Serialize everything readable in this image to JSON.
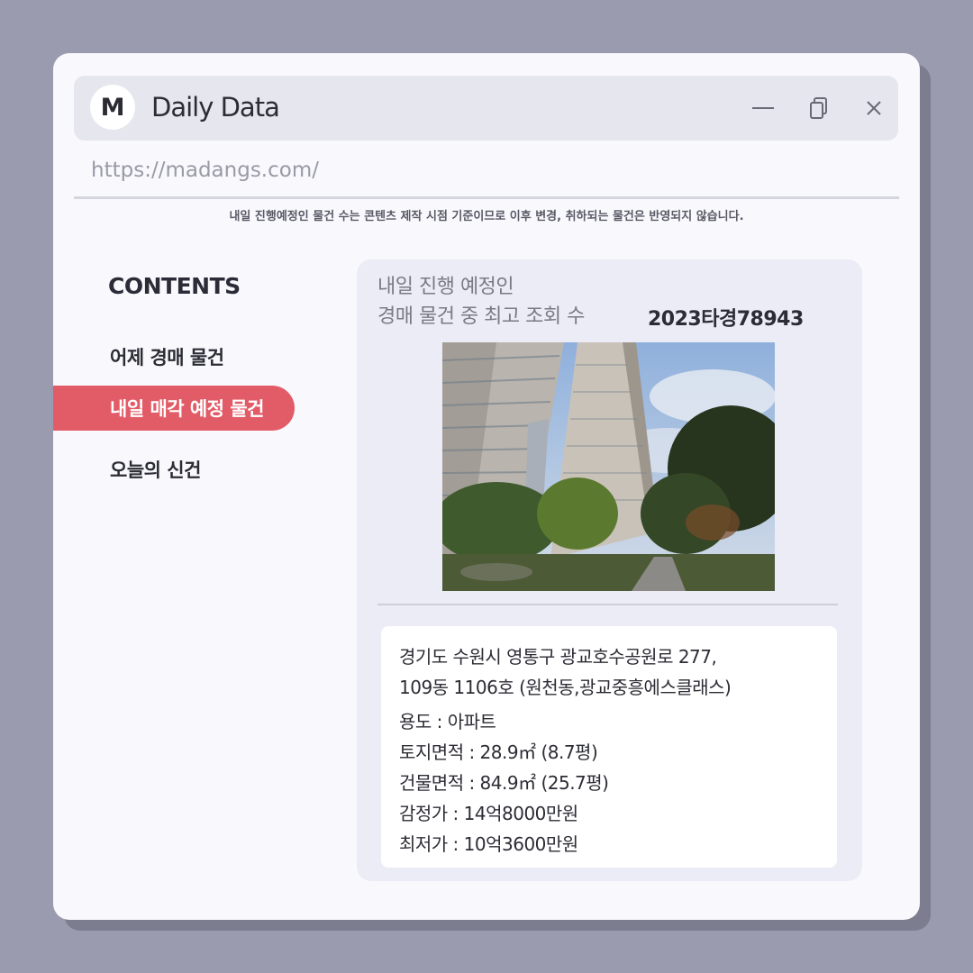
{
  "app": {
    "logo_letter": "M",
    "title": "Daily Data",
    "url": "https://madangs.com/"
  },
  "notice": "내일 진행예정인 물건 수는 콘텐츠 제작 시점 기준이므로 이후 변경, 취하되는 물건은 반영되지 않습니다.",
  "sidebar": {
    "heading": "CONTENTS",
    "items": [
      {
        "label": "어제 경매 물건",
        "active": false
      },
      {
        "label": "내일 매각 예정 물건",
        "active": true
      },
      {
        "label": "오늘의 신건",
        "active": false
      }
    ]
  },
  "card": {
    "title_line1": "내일 진행 예정인",
    "title_line2": "경매 물건 중 최고 조회 수",
    "case_number": "2023타경78943",
    "details": {
      "address_line1": "경기도 수원시 영통구 광교호수공원로 277,",
      "address_line2": "109동 1106호 (원천동,광교중흥에스클래스)",
      "usage": "용도 : 아파트",
      "land_area": "토지면적 : 28.9㎡ (8.7평)",
      "building_area": "건물면적 : 84.9㎡ (25.7평)",
      "appraisal": "감정가 : 14억8000만원",
      "minimum_price": "최저가 : 10억3600만원"
    }
  },
  "colors": {
    "background": "#9a9bae",
    "window": "#f8f8fd",
    "accent": "#e25c67",
    "titlebar": "#e6e6ee"
  },
  "icons": [
    "minimize-icon",
    "copy-icon",
    "close-icon"
  ]
}
